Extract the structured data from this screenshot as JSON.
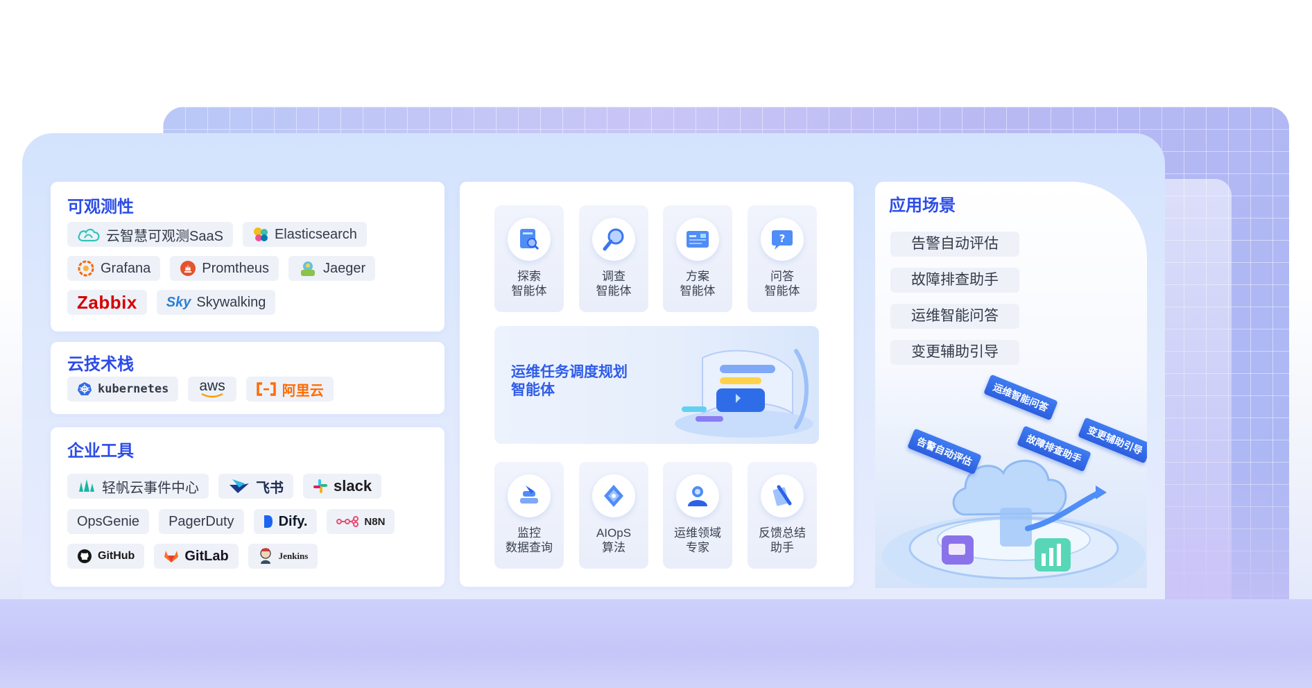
{
  "observability": {
    "title": "可观测性",
    "items": [
      {
        "label": "云智慧可观测SaaS",
        "icon": "cloud-icon"
      },
      {
        "label": "Elasticsearch",
        "icon": "elasticsearch-icon"
      },
      {
        "label": "Grafana",
        "icon": "grafana-icon"
      },
      {
        "label": "Promtheus",
        "icon": "prometheus-icon"
      },
      {
        "label": "Jaeger",
        "icon": "jaeger-icon"
      },
      {
        "label": "Zabbix",
        "icon": "zabbix-logo"
      },
      {
        "label": "Sky",
        "icon": "skywalking-icon"
      },
      {
        "label": "Skywalking",
        "icon": "skywalking-icon"
      }
    ]
  },
  "cloud_stack": {
    "title": "云技术栈",
    "items": [
      {
        "label": "kubernetes",
        "icon": "kubernetes-icon"
      },
      {
        "label": "aws",
        "icon": "aws-logo"
      },
      {
        "label": "阿里云",
        "icon": "aliyun-icon"
      }
    ]
  },
  "enterprise_tools": {
    "title": "企业工具",
    "items": [
      {
        "label": "轻帆云事件中心",
        "icon": "qingfan-icon"
      },
      {
        "label": "飞书",
        "icon": "feishu-icon"
      },
      {
        "label": "slack",
        "icon": "slack-icon"
      },
      {
        "label": "OpsGenie"
      },
      {
        "label": "PagerDuty"
      },
      {
        "label": "Dify.",
        "icon": "dify-icon"
      },
      {
        "label": "N8N",
        "icon": "n8n-icon"
      },
      {
        "label": "GitHub",
        "icon": "github-icon"
      },
      {
        "label": "GitLab",
        "icon": "gitlab-icon"
      },
      {
        "label": "Jenkins",
        "icon": "jenkins-icon"
      }
    ]
  },
  "agents_top": [
    {
      "line1": "探索",
      "line2": "智能体",
      "icon": "explore-icon"
    },
    {
      "line1": "调查",
      "line2": "智能体",
      "icon": "investigate-icon"
    },
    {
      "line1": "方案",
      "line2": "智能体",
      "icon": "plan-icon"
    },
    {
      "line1": "问答",
      "line2": "智能体",
      "icon": "qa-icon"
    }
  ],
  "banner": {
    "line1": "运维任务调度规划",
    "line2": "智能体"
  },
  "agents_bottom": [
    {
      "line1": "监控",
      "line2": "数据查询",
      "icon": "monitor-query-icon"
    },
    {
      "line1": "AIOpS",
      "line2": "算法",
      "icon": "aiops-icon"
    },
    {
      "line1": "运维领域",
      "line2": "专家",
      "icon": "expert-icon"
    },
    {
      "line1": "反馈总结",
      "line2": "助手",
      "icon": "feedback-icon"
    }
  ],
  "scenarios": {
    "title": "应用场景",
    "items": [
      "告警自动评估",
      "故障排查助手",
      "运维智能问答",
      "变更辅助引导"
    ],
    "tags": [
      "运维智能问答",
      "告警自动评估",
      "故障排查助手",
      "变更辅助引导"
    ]
  },
  "colors": {
    "accent": "#2c4ce6",
    "banner_text": "#2f5ce8",
    "zabbix": "#d40000",
    "aliyun": "#ff6a00"
  }
}
